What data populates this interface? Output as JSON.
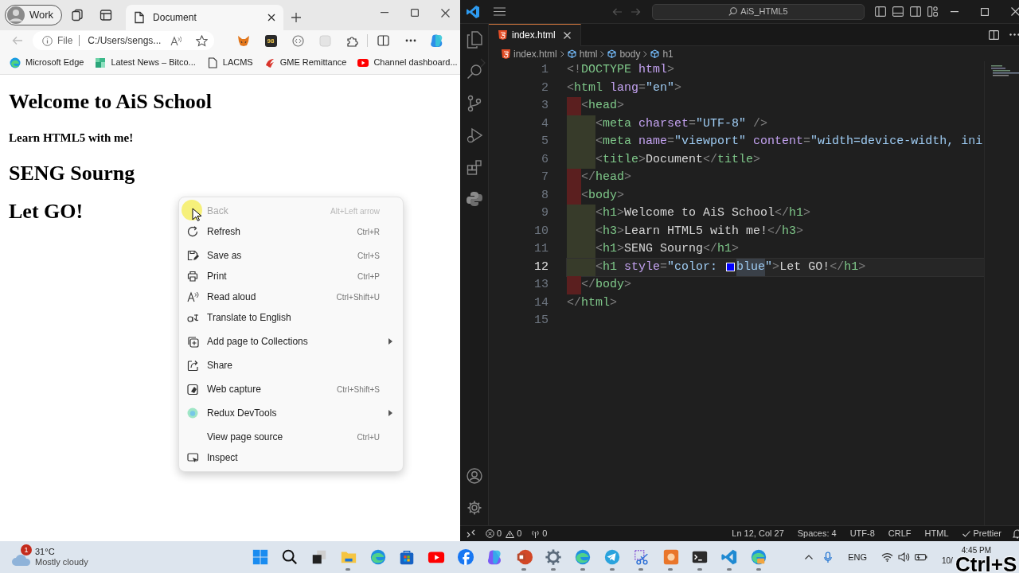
{
  "browser": {
    "profile": "Work",
    "tab": {
      "title": "Document",
      "selected": true
    },
    "address": {
      "scheme": "File",
      "url": "C:/Users/sengs..."
    },
    "extension_badge": "98",
    "bookmarks": [
      {
        "label": "Microsoft Edge"
      },
      {
        "label": "Latest News – Bitco..."
      },
      {
        "label": "LACMS"
      },
      {
        "label": "GME Remittance"
      },
      {
        "label": "Channel dashboard..."
      }
    ],
    "page": [
      {
        "kind": "h1",
        "text": "Welcome to AiS School"
      },
      {
        "kind": "h3",
        "text": "Learn HTML5 with me!"
      },
      {
        "kind": "h1",
        "text": "SENG Sourng"
      },
      {
        "kind": "h1",
        "text": "Let GO!"
      }
    ],
    "context_menu": {
      "groups": [
        [
          {
            "label": "Back",
            "shortcut": "Alt+Left arrow",
            "disabled": true,
            "submenu": false
          },
          {
            "label": "Refresh",
            "shortcut": "Ctrl+R",
            "disabled": false,
            "submenu": false
          }
        ],
        [
          {
            "label": "Save as",
            "shortcut": "Ctrl+S",
            "disabled": false,
            "submenu": false
          },
          {
            "label": "Print",
            "shortcut": "Ctrl+P",
            "disabled": false,
            "submenu": false
          },
          {
            "label": "Read aloud",
            "shortcut": "Ctrl+Shift+U",
            "disabled": false,
            "submenu": false
          },
          {
            "label": "Translate to English",
            "disabled": false,
            "submenu": false
          }
        ],
        [
          {
            "label": "Add page to Collections",
            "disabled": false,
            "submenu": true
          }
        ],
        [
          {
            "label": "Share",
            "disabled": false,
            "submenu": false
          }
        ],
        [
          {
            "label": "Web capture",
            "shortcut": "Ctrl+Shift+S",
            "disabled": false,
            "submenu": false
          }
        ],
        [
          {
            "label": "Redux DevTools",
            "disabled": false,
            "submenu": true
          }
        ],
        [
          {
            "label": "View page source",
            "shortcut": "Ctrl+U",
            "disabled": false,
            "submenu": false
          },
          {
            "label": "Inspect",
            "disabled": false,
            "submenu": false
          }
        ]
      ]
    }
  },
  "editor": {
    "search": "AiS_HTML5",
    "tabs": [
      {
        "label": "index.html",
        "selected": true
      }
    ],
    "breadcrumbs": [
      "index.html",
      "html",
      "body",
      "h1"
    ],
    "lines": [
      {
        "number": "1",
        "current": false,
        "tokens": [
          {
            "kind": "punct",
            "s": "<!"
          },
          {
            "kind": "tag",
            "s": "DOCTYPE"
          },
          {
            "kind": "attr",
            "s": " html"
          },
          {
            "kind": "punct",
            "s": ">"
          }
        ]
      },
      {
        "number": "2",
        "current": false,
        "tokens": [
          {
            "kind": "punct",
            "s": "<"
          },
          {
            "kind": "tag",
            "s": "html"
          },
          {
            "kind": "attr",
            "s": " lang"
          },
          {
            "kind": "punct",
            "s": "="
          },
          {
            "kind": "string",
            "s": "\"en\""
          },
          {
            "kind": "punct",
            "s": ">"
          }
        ]
      },
      {
        "number": "3",
        "current": false,
        "tokens": [
          {
            "kind": "punct",
            "s": "  <"
          },
          {
            "kind": "tag",
            "s": "head"
          },
          {
            "kind": "punct",
            "s": ">"
          }
        ]
      },
      {
        "number": "4",
        "current": false,
        "tokens": [
          {
            "kind": "punct",
            "s": "    <"
          },
          {
            "kind": "tag",
            "s": "meta"
          },
          {
            "kind": "attr",
            "s": " charset"
          },
          {
            "kind": "punct",
            "s": "="
          },
          {
            "kind": "string",
            "s": "\"UTF-8\""
          },
          {
            "kind": "punct",
            "s": " />"
          }
        ]
      },
      {
        "number": "5",
        "current": false,
        "tokens": [
          {
            "kind": "punct",
            "s": "    <"
          },
          {
            "kind": "tag",
            "s": "meta"
          },
          {
            "kind": "attr",
            "s": " name"
          },
          {
            "kind": "punct",
            "s": "="
          },
          {
            "kind": "string",
            "s": "\"viewport\""
          },
          {
            "kind": "attr",
            "s": " content"
          },
          {
            "kind": "punct",
            "s": "="
          },
          {
            "kind": "string",
            "s": "\"width=device-width, ini"
          }
        ]
      },
      {
        "number": "6",
        "current": false,
        "tokens": [
          {
            "kind": "punct",
            "s": "    <"
          },
          {
            "kind": "tag",
            "s": "title"
          },
          {
            "kind": "punct",
            "s": ">"
          },
          {
            "kind": "text",
            "s": "Document"
          },
          {
            "kind": "punct",
            "s": "</"
          },
          {
            "kind": "tag",
            "s": "title"
          },
          {
            "kind": "punct",
            "s": ">"
          }
        ]
      },
      {
        "number": "7",
        "current": false,
        "tokens": [
          {
            "kind": "punct",
            "s": "  </"
          },
          {
            "kind": "tag",
            "s": "head"
          },
          {
            "kind": "punct",
            "s": ">"
          }
        ]
      },
      {
        "number": "8",
        "current": false,
        "tokens": [
          {
            "kind": "punct",
            "s": "  <"
          },
          {
            "kind": "tag",
            "s": "body"
          },
          {
            "kind": "punct",
            "s": ">"
          }
        ]
      },
      {
        "number": "9",
        "current": false,
        "tokens": [
          {
            "kind": "punct",
            "s": "    <"
          },
          {
            "kind": "tag",
            "s": "h1"
          },
          {
            "kind": "punct",
            "s": ">"
          },
          {
            "kind": "text",
            "s": "Welcome to AiS School"
          },
          {
            "kind": "punct",
            "s": "</"
          },
          {
            "kind": "tag",
            "s": "h1"
          },
          {
            "kind": "punct",
            "s": ">"
          }
        ]
      },
      {
        "number": "10",
        "current": false,
        "tokens": [
          {
            "kind": "punct",
            "s": "    <"
          },
          {
            "kind": "tag",
            "s": "h3"
          },
          {
            "kind": "punct",
            "s": ">"
          },
          {
            "kind": "text",
            "s": "Learn HTML5 with me!"
          },
          {
            "kind": "punct",
            "s": "</"
          },
          {
            "kind": "tag",
            "s": "h3"
          },
          {
            "kind": "punct",
            "s": ">"
          }
        ]
      },
      {
        "number": "11",
        "current": false,
        "tokens": [
          {
            "kind": "punct",
            "s": "    <"
          },
          {
            "kind": "tag",
            "s": "h1"
          },
          {
            "kind": "punct",
            "s": ">"
          },
          {
            "kind": "text",
            "s": "SENG Sourng"
          },
          {
            "kind": "punct",
            "s": "</"
          },
          {
            "kind": "tag",
            "s": "h1"
          },
          {
            "kind": "punct",
            "s": ">"
          }
        ]
      },
      {
        "number": "12",
        "current": true,
        "tokens": [
          {
            "kind": "punct",
            "s": "    <"
          },
          {
            "kind": "tag",
            "s": "h1"
          },
          {
            "kind": "attr",
            "s": " style"
          },
          {
            "kind": "punct",
            "s": "="
          },
          {
            "kind": "string",
            "s": "\"color: "
          },
          {
            "kind": "swatch",
            "color": "#0000ff"
          },
          {
            "kind": "match",
            "s": "blue"
          },
          {
            "kind": "string",
            "s": "\""
          },
          {
            "kind": "punct",
            "s": ">"
          },
          {
            "kind": "text",
            "s": "Let GO!"
          },
          {
            "kind": "punct",
            "s": "</"
          },
          {
            "kind": "tag",
            "s": "h1"
          },
          {
            "kind": "punct",
            "s": ">"
          }
        ]
      },
      {
        "number": "13",
        "current": false,
        "tokens": [
          {
            "kind": "punct",
            "s": "  </"
          },
          {
            "kind": "tag",
            "s": "body"
          },
          {
            "kind": "punct",
            "s": ">"
          }
        ]
      },
      {
        "number": "14",
        "current": false,
        "tokens": [
          {
            "kind": "punct",
            "s": "</"
          },
          {
            "kind": "tag",
            "s": "html"
          },
          {
            "kind": "punct",
            "s": ">"
          }
        ]
      },
      {
        "number": "15",
        "current": false
      }
    ],
    "status": {
      "errors": "0",
      "warnings": "0",
      "ports": "0",
      "items": [
        "Ln 12, Col 27",
        "Spaces: 4",
        "UTF-8",
        "CRLF",
        "HTML"
      ],
      "formatter": "Prettier"
    }
  },
  "taskbar": {
    "weather": {
      "badge": "1",
      "temperature": "31°C",
      "condition": "Mostly cloudy"
    },
    "apps": [
      {
        "running": false
      },
      {
        "running": false
      },
      {
        "running": false
      },
      {
        "running": true
      },
      {
        "running": false
      },
      {
        "running": false
      },
      {
        "running": false
      },
      {
        "running": false
      },
      {
        "running": false
      },
      {
        "running": true
      },
      {
        "running": true
      },
      {
        "running": true
      },
      {
        "running": true
      },
      {
        "running": true
      },
      {
        "running": true
      },
      {
        "running": true
      },
      {
        "running": true
      },
      {
        "running": true
      }
    ],
    "language": "ENG",
    "time": "4:45 PM",
    "date": "10/"
  },
  "key_overlay": "Ctrl+S"
}
